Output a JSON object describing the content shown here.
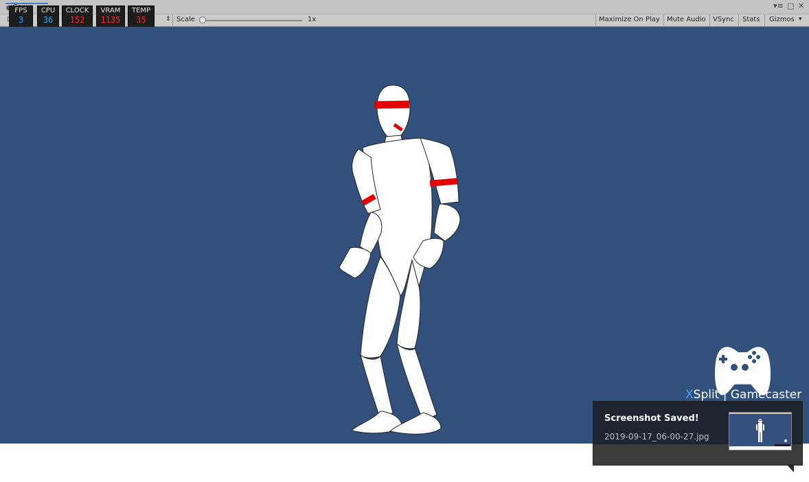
{
  "window": {
    "tab_label": "Game",
    "controls": {
      "menu": "▾≡",
      "maximize": "□",
      "close": "✕"
    }
  },
  "toolbar": {
    "display_partial": "Di",
    "scale_label": "Scale",
    "scale_value": "1x",
    "scale_level": 0.0,
    "buttons": [
      "Maximize On Play",
      "Mute Audio",
      "VSync",
      "Stats",
      "Gizmos"
    ],
    "gizmos_arrow": "▾",
    "updown_arrow": "⇕"
  },
  "hud": {
    "fps": {
      "label": "FPS",
      "value": "3",
      "color": "#2aa8ff"
    },
    "cpu": {
      "label": "CPU",
      "value": "36",
      "color": "#2aa8ff"
    },
    "clock": {
      "label": "CLOCK",
      "value": "152",
      "color": "#ff2a2a"
    },
    "vram": {
      "label": "VRAM",
      "value": "1135",
      "color": "#ff2a2a"
    },
    "temp": {
      "label": "TEMP",
      "value": "35",
      "color": "#ff2a2a"
    }
  },
  "scene": {
    "background_color": "#32507c",
    "figure": "mannequin-character"
  },
  "brand": {
    "x": "X",
    "name": "Split | Gamecaster"
  },
  "toast": {
    "title": "Screenshot Saved!",
    "filename": "2019-09-17_06-00-27.jpg"
  }
}
